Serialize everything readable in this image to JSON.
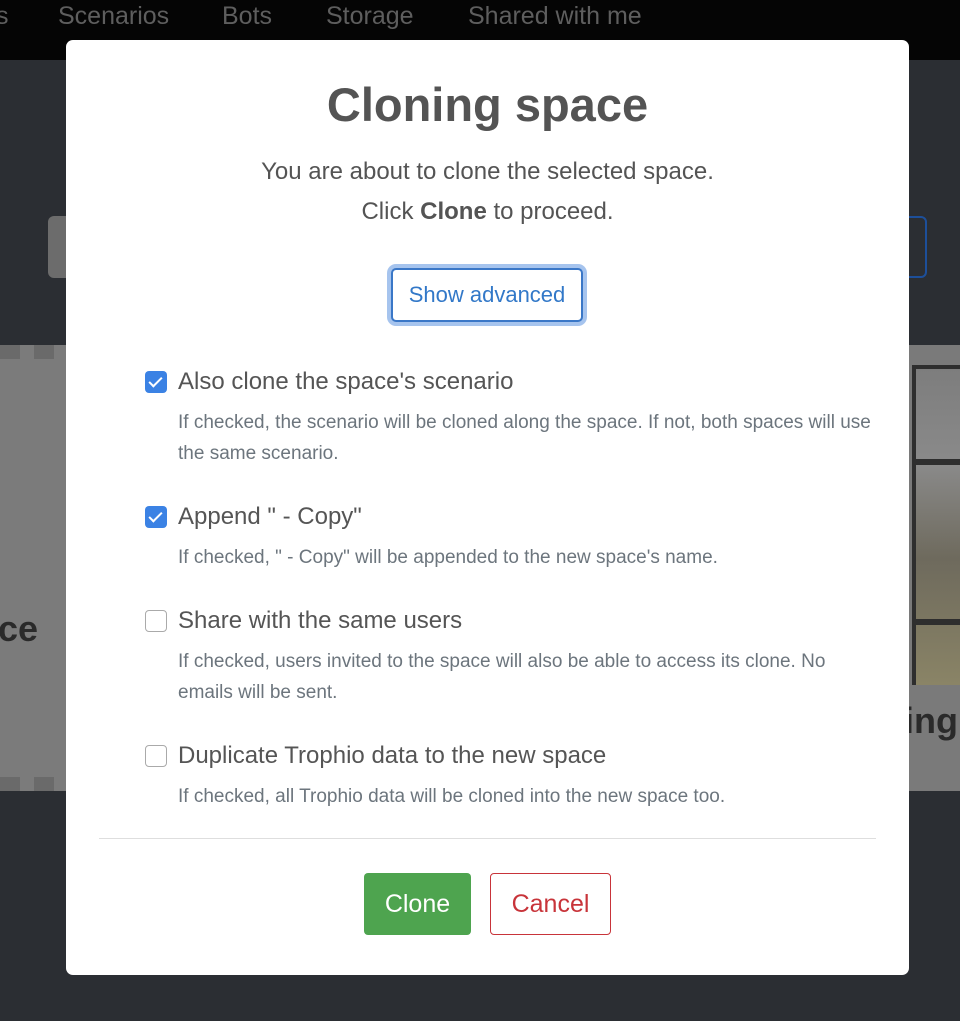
{
  "nav": {
    "items": [
      {
        "label": "s"
      },
      {
        "label": "Scenarios"
      },
      {
        "label": "Bots"
      },
      {
        "label": "Storage"
      },
      {
        "label": "Shared with me"
      }
    ]
  },
  "background": {
    "left_card_text": "ce",
    "right_card_text": "ing"
  },
  "modal": {
    "title": "Cloning space",
    "intro_line1": "You are about to clone the selected space.",
    "intro_line2_prefix": "Click ",
    "intro_line2_bold": "Clone",
    "intro_line2_suffix": " to proceed.",
    "show_advanced_label": "Show advanced",
    "options": [
      {
        "label": "Also clone the space's scenario",
        "checked": true,
        "help": "If checked, the scenario will be cloned along the space. If not, both spaces will use the same scenario."
      },
      {
        "label": "Append \" - Copy\"",
        "checked": true,
        "help": "If checked, \" - Copy\" will be appended to the new space's name."
      },
      {
        "label": "Share with the same users",
        "checked": false,
        "help": "If checked, users invited to the space will also be able to access its clone. No emails will be sent."
      },
      {
        "label": "Duplicate Trophio data to the new space",
        "checked": false,
        "help": "If checked, all Trophio data will be cloned into the new space too."
      }
    ],
    "clone_label": "Clone",
    "cancel_label": "Cancel"
  },
  "colors": {
    "primary_blue": "#3b82e4",
    "success_green": "#4ea44f",
    "danger_red": "#c8343a"
  }
}
